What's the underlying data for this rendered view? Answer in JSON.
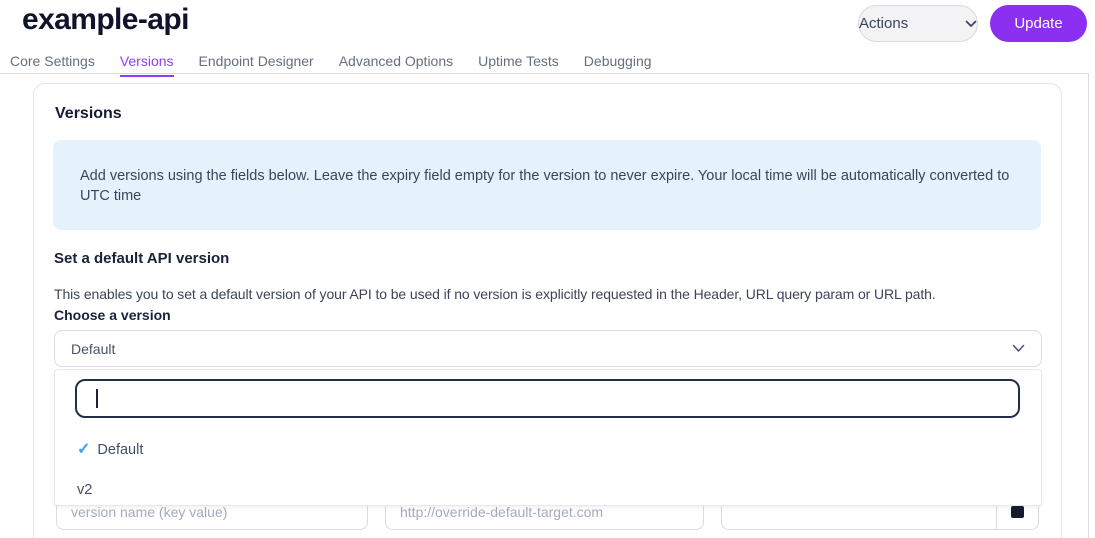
{
  "header": {
    "title": "example-api",
    "actions_label": "Actions",
    "update_label": "Update"
  },
  "tabs": [
    {
      "label": "Core Settings",
      "active": false
    },
    {
      "label": "Versions",
      "active": true
    },
    {
      "label": "Endpoint Designer",
      "active": false
    },
    {
      "label": "Advanced Options",
      "active": false
    },
    {
      "label": "Uptime Tests",
      "active": false
    },
    {
      "label": "Debugging",
      "active": false
    }
  ],
  "versions_section": {
    "heading": "Versions",
    "info_text": "Add versions using the fields below. Leave the expiry field empty for the version to never expire. Your local time will be automatically converted to UTC time",
    "default_version": {
      "heading": "Set a default API version",
      "description": "This enables you to set a default version of your API to be used if no version is explicitly requested in the Header, URL query param or URL path.",
      "choose_label": "Choose a version",
      "selected_value": "Default"
    },
    "dropdown": {
      "search_value": "",
      "options": [
        {
          "label": "Default",
          "selected": true
        },
        {
          "label": "v2",
          "selected": false
        }
      ]
    },
    "add_version_fields": {
      "name_placeholder": "version name (key value)",
      "target_placeholder": "http://override-default-target.com",
      "expiry_value": ""
    }
  },
  "icons": {
    "check": "✓"
  },
  "colors": {
    "accent_purple": "#8b2ff0",
    "tab_active_purple": "#8b3df7",
    "info_box_bg": "#e4f2fc",
    "check_blue": "#41a0e9",
    "calendar_icon": "#161c30"
  }
}
